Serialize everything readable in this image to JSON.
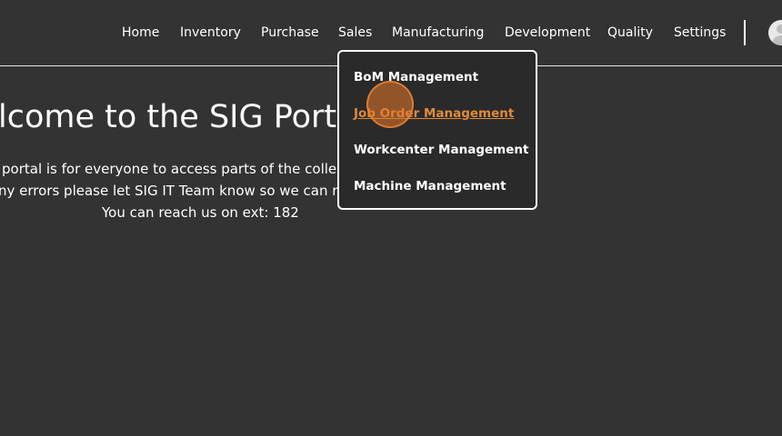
{
  "nav": {
    "items": [
      {
        "label": "Home"
      },
      {
        "label": "Inventory"
      },
      {
        "label": "Purchase"
      },
      {
        "label": "Sales"
      },
      {
        "label": "Manufacturing"
      },
      {
        "label": "Development"
      },
      {
        "label": "Quality"
      },
      {
        "label": "Settings"
      }
    ],
    "avatar_icon": "user-avatar-icon"
  },
  "welcome": {
    "title": "lcome to the SIG Porta",
    "line1": "portal is for everyone to access parts of the collec",
    "line2": "ny errors please let SIG IT Team know so we can re",
    "line3": "You can reach us on ext: 182"
  },
  "dropdown": {
    "items": [
      {
        "label": "BoM Management"
      },
      {
        "label": "Job Order Management"
      },
      {
        "label": "Workcenter Management"
      },
      {
        "label": "Machine Management"
      }
    ],
    "active_color": "#e08a3a"
  },
  "colors": {
    "background": "#333333",
    "dropdown_bg": "#2a2a2a",
    "accent": "#e08a3a"
  }
}
